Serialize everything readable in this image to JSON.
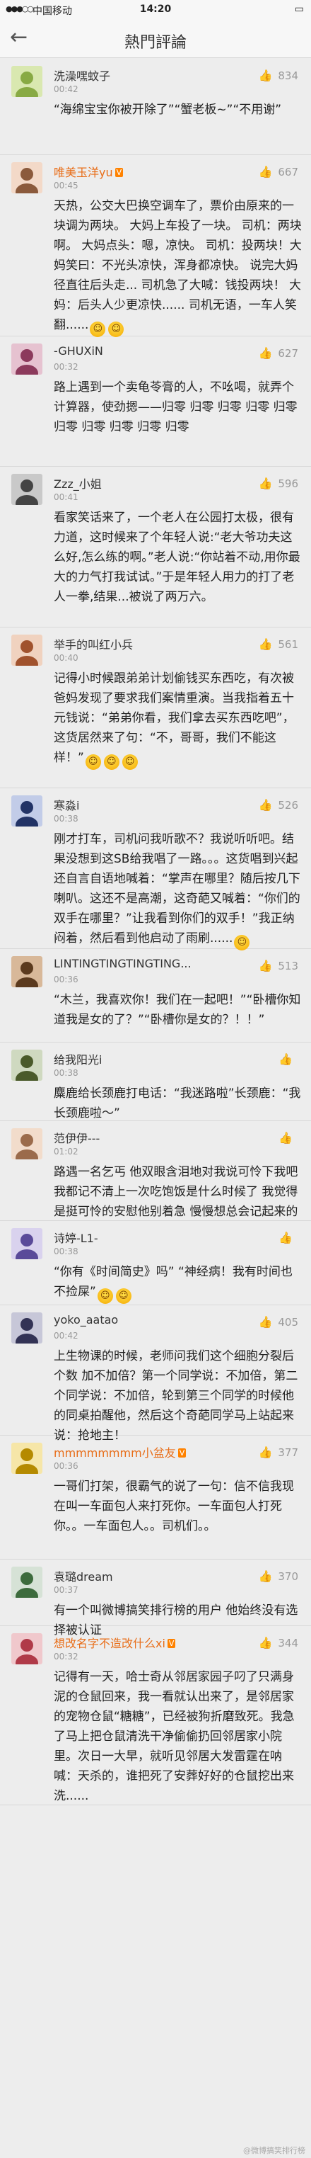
{
  "status_bar": {
    "signal": "●●●○○",
    "carrier": "中国移动",
    "wifi_icon": "wifi-icon",
    "time": "14:20",
    "battery": "▭"
  },
  "nav": {
    "back_icon": "←",
    "title": "熱門評論"
  },
  "comments": [
    {
      "name": "洗澡嘿蚊子",
      "verified": false,
      "time": "00:42",
      "likes": "834",
      "text": "“海绵宝宝你被开除了”“蟹老板~”“不用谢”"
    },
    {
      "name": "唯美玉洋yu",
      "verified": true,
      "time": "00:45",
      "likes": "667",
      "text": "天热，公交大巴换空调车了，票价由原来的一块调为两块。 大妈上车投了一块。 司机：两块啊。 大妈点头：嗯，凉快。 司机：投两块！大妈笑曰：不光头凉快，浑身都凉快。 说完大妈径直往后头走... 司机急了大喊：钱投两块！ 大妈：后头人少更凉快...... 司机无语，一车人笑翻......"
    },
    {
      "name": "-GHUXiN",
      "verified": false,
      "time": "00:32",
      "likes": "627",
      "text": "路上遇到一个卖龟苓膏的人，不吆喝，就弄个计算器，使劲摁——归零 归零 归零 归零 归零 归零 归零 归零 归零 归零"
    },
    {
      "name": "Zzz_小姐",
      "verified": false,
      "time": "00:41",
      "likes": "596",
      "text": "看家笑话来了，一个老人在公园打太极，很有力道，这时候来了个年轻人说:“老大爷功夫这么好,怎么练的啊。”老人说:“你站着不动,用你最大的力气打我试试。”于是年轻人用力的打了老人一拳,结果...被说了两万六。"
    },
    {
      "name": "举手的叫红小兵",
      "verified": false,
      "time": "00:40",
      "likes": "561",
      "text": "记得小时候跟弟弟计划偷钱买东西吃，有次被爸妈发现了要求我们案情重演。当我指着五十元钱说：“弟弟你看，我们拿去买东西吃吧”，这货居然来了句：“不，哥哥，我们不能这样！”"
    },
    {
      "name": "寒淼i",
      "verified": false,
      "time": "00:38",
      "likes": "526",
      "text": "刚才打车，司机问我听歌不？我说听听吧。结果没想到这SB给我唱了一路。。。这货唱到兴起还自言自语地喊着：“掌声在哪里？随后按几下喇叭。这还不是高潮，这奇葩又喊着：“你们的双手在哪里？”让我看到你们的双手！”我正纳闷着，然后看到他启动了雨刷......"
    },
    {
      "name": "LINTINGTINGTINGTING...",
      "verified": false,
      "time": "00:36",
      "likes": "513",
      "text": "“木兰，我喜欢你！我们在一起吧！”“卧槽你知道我是女的了？”“卧槽你是女的？！！”"
    },
    {
      "name": "给我阳光i",
      "verified": false,
      "time": "00:38",
      "likes": "",
      "text": "麋鹿给长颈鹿打电话：“我迷路啦”长颈鹿：“我长颈鹿啦～”"
    },
    {
      "name": "范伊伊---",
      "verified": false,
      "time": "01:02",
      "likes": "",
      "text": "路遇一名乞丐 他双眼含泪地对我说可怜下我吧我都记不清上一次吃饱饭是什么时候了 我觉得是挺可怜的安慰他别着急 慢慢想总会记起来的"
    },
    {
      "name": "诗婷-L1-",
      "verified": false,
      "time": "00:38",
      "likes": "",
      "text": "“你有《时间简史》吗” “神经病！我有时间也不捡屎”"
    },
    {
      "name": "yoko_aatao",
      "verified": false,
      "time": "00:42",
      "likes": "405",
      "text": "上生物课的时候，老师问我们这个细胞分裂后个数 加不加倍？第一个同学说：不加倍，第二个同学说：不加倍，轮到第三个同学的时候他的同桌拍醒他，然后这个奇葩同学马上站起来说：抢地主！"
    },
    {
      "name": "mmmmmmmm小盆友",
      "verified": true,
      "time": "00:36",
      "likes": "377",
      "text": "一哥们打架，很霸气的说了一句：信不信我现在叫一车面包人来打死你。一车面包人打死你。。一车面包人。。司机们。。"
    },
    {
      "name": "袁璐dream",
      "verified": false,
      "time": "00:37",
      "likes": "370",
      "text": "有一个叫微博搞笑排行榜的用户 他始终没有选择被认证"
    },
    {
      "name": "想改名字不造改什么xi",
      "verified": true,
      "time": "00:32",
      "likes": "344",
      "text": "记得有一天，哈士奇从邻居家园子叼了只满身泥的仓鼠回来，我一看就认出来了，是邻居家的宠物仓鼠“糖糖”，已经被狗折磨致死。我急了马上把仓鼠清洗干净偷偷扔回邻居家小院里。次日一大早，就听见邻居大发雷霆在呐喊：天杀的，谁把死了安葬好好的仓鼠挖出来洗......"
    }
  ],
  "watermark": "@微博搞笑排行榜"
}
